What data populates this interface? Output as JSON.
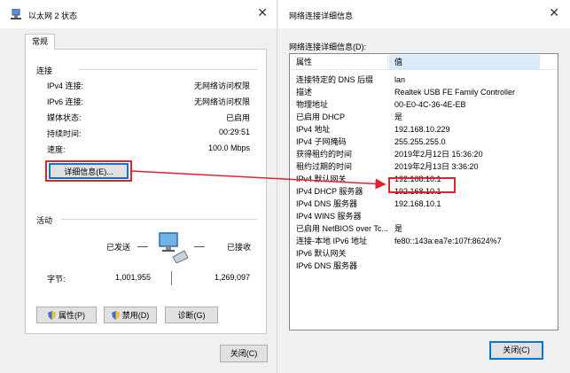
{
  "left_window": {
    "title": "以太网 2 状态",
    "tab": "常规",
    "connection": {
      "title": "连接",
      "rows": [
        {
          "label": "IPv4 连接:",
          "value": "无网络访问权限"
        },
        {
          "label": "IPv6 连接:",
          "value": "无网络访问权限"
        },
        {
          "label": "媒体状态:",
          "value": "已启用"
        },
        {
          "label": "持续时间:",
          "value": "00:29:51"
        },
        {
          "label": "速度:",
          "value": "100.0 Mbps"
        }
      ],
      "details_button": "详细信息(E)..."
    },
    "activity": {
      "title": "活动",
      "sent_label": "已发送",
      "received_label": "已接收",
      "bytes_label": "字节:",
      "sent_value": "1,001,955",
      "received_value": "1,269,097"
    },
    "buttons": {
      "properties": "属性(P)",
      "disable": "禁用(D)",
      "diagnose": "诊断(G)",
      "close": "关闭(C)"
    }
  },
  "right_window": {
    "title": "网络连接详细信息",
    "list_label": "网络连接详细信息(D):",
    "columns": [
      "属性",
      "值"
    ],
    "rows": [
      {
        "property": "连接特定的 DNS 后缀",
        "value": "lan"
      },
      {
        "property": "描述",
        "value": "Realtek USB FE Family Controller"
      },
      {
        "property": "物理地址",
        "value": "00-E0-4C-36-4E-EB"
      },
      {
        "property": "已启用 DHCP",
        "value": "是"
      },
      {
        "property": "IPv4 地址",
        "value": "192.168.10.229"
      },
      {
        "property": "IPv4 子网掩码",
        "value": "255.255.255.0"
      },
      {
        "property": "获得租约的时间",
        "value": "2019年2月12日 15:36:20"
      },
      {
        "property": "租约过期的时间",
        "value": "2019年2月13日 3:36:20"
      },
      {
        "property": "IPv4 默认网关",
        "value": "192.168.10.1"
      },
      {
        "property": "IPv4 DHCP 服务器",
        "value": "192.168.10.1"
      },
      {
        "property": "IPv4 DNS 服务器",
        "value": "192.168.10.1"
      },
      {
        "property": "IPv4 WINS 服务器",
        "value": ""
      },
      {
        "property": "已启用 NetBIOS over Tc...",
        "value": "是"
      },
      {
        "property": "连接-本地 IPv6 地址",
        "value": "fe80::143a:ea7e:107f:8624%7"
      },
      {
        "property": "IPv6 默认网关",
        "value": ""
      },
      {
        "property": "IPv6 DNS 服务器",
        "value": ""
      }
    ],
    "close_button": "关闭(C)"
  },
  "colors": {
    "highlight": "#e0242c",
    "focus_border": "#0078d7",
    "window_bg": "#f0f0f0"
  }
}
